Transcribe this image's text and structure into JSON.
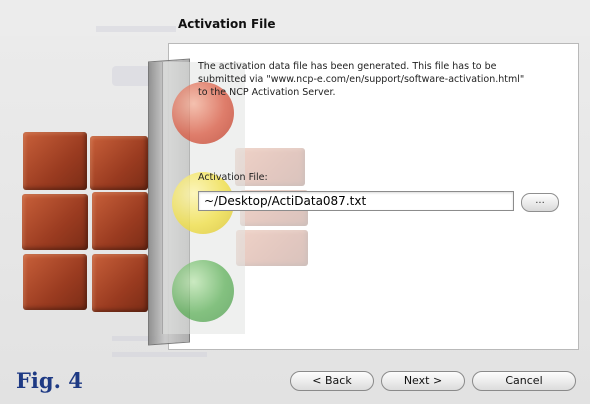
{
  "header": {
    "title": "Activation File"
  },
  "content": {
    "description_lines": [
      "The activation data file has been generated. This file has to be",
      "submitted via \"www.ncp-e.com/en/support/software-activation.html\"",
      "to the NCP Activation Server."
    ],
    "field_label": "Activation File:",
    "field_value": "~/Desktop/ActiData087.txt",
    "browse_label": "..."
  },
  "footer": {
    "figure_label": "Fig. 4",
    "back_label": "< Back",
    "next_label": "Next >",
    "cancel_label": "Cancel"
  },
  "colors": {
    "figure_label": "#1e3a84",
    "panel": "#ffffff",
    "background": "#ececec"
  },
  "icons": [
    "traffic-light-graphic",
    "brick-wall-graphic"
  ]
}
